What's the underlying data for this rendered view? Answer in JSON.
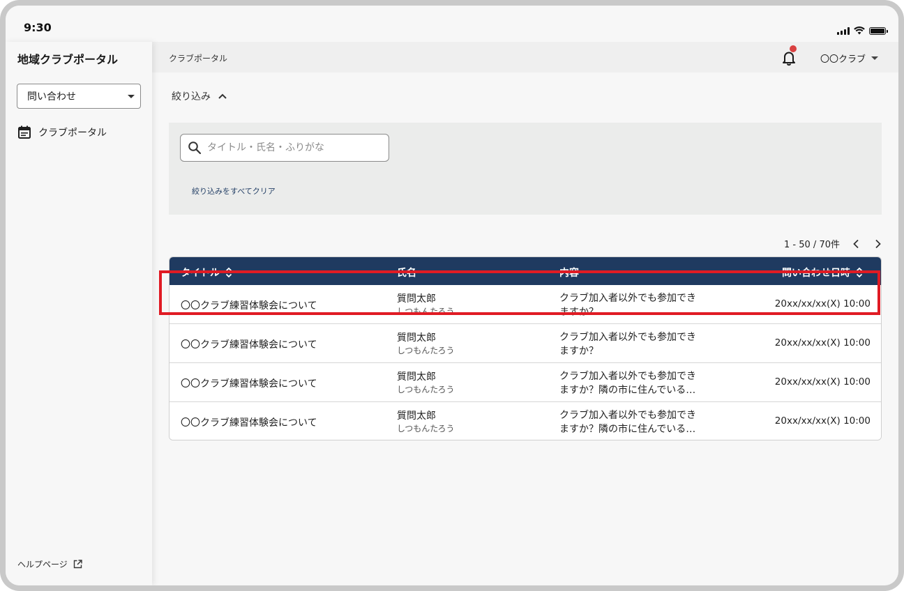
{
  "status_bar": {
    "time": "9:30"
  },
  "sidebar": {
    "app_title": "地域クラブポータル",
    "select_value": "問い合わせ",
    "nav_items": [
      {
        "label": "クラブポータル",
        "icon": "calendar-icon"
      }
    ],
    "help_label": "ヘルプページ"
  },
  "header": {
    "breadcrumb": "クラブポータル",
    "user_label": "〇〇クラブ",
    "notification_dot_color": "#d94040"
  },
  "filter": {
    "toggle_label": "絞り込み",
    "search_placeholder": "タイトル・氏名・ふりがな",
    "search_value": "",
    "clear_label": "絞り込みをすべてクリア"
  },
  "pagination": {
    "range_text": "1 - 50 / 70件"
  },
  "table": {
    "header_color": "#1f3a60",
    "columns": [
      "タイトル",
      "氏名",
      "内容",
      "問い合わせ日時"
    ],
    "rows": [
      {
        "title": "〇〇クラブ練習体験会について",
        "name": "質問太郎",
        "kana": "しつもんたろう",
        "body_line1": "クラブ加入者以外でも参加でき",
        "body_line2": "ますか？",
        "datetime": "20xx/xx/xx(X) 10:00"
      },
      {
        "title": "〇〇クラブ練習体験会について",
        "name": "質問太郎",
        "kana": "しつもんたろう",
        "body_line1": "クラブ加入者以外でも参加でき",
        "body_line2": "ますか？",
        "datetime": "20xx/xx/xx(X) 10:00"
      },
      {
        "title": "〇〇クラブ練習体験会について",
        "name": "質問太郎",
        "kana": "しつもんたろう",
        "body_line1": "クラブ加入者以外でも参加でき",
        "body_line2": "ますか？隣の市に住んでいる…",
        "datetime": "20xx/xx/xx(X) 10:00"
      },
      {
        "title": "〇〇クラブ練習体験会について",
        "name": "質問太郎",
        "kana": "しつもんたろう",
        "body_line1": "クラブ加入者以外でも参加でき",
        "body_line2": "ますか？隣の市に住んでいる…",
        "datetime": "20xx/xx/xx(X) 10:00"
      }
    ]
  },
  "highlight_color": "#e01b24"
}
